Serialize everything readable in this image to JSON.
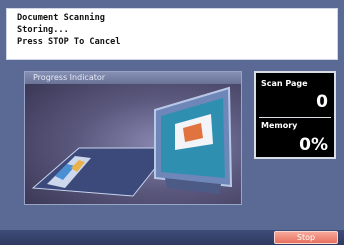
{
  "message": {
    "line1": "Document Scanning",
    "line2": "Storing...",
    "line3": "Press STOP To Cancel"
  },
  "progress": {
    "title": "Progress Indicator"
  },
  "counter": {
    "scan_page_label": "Scan Page",
    "scan_page_value": "0",
    "memory_label": "Memory",
    "memory_value": "0%"
  },
  "actions": {
    "stop_label": "Stop"
  },
  "colors": {
    "background": "#5a6a94",
    "stop_button": "#e8705e",
    "counter_bg": "#000000"
  }
}
